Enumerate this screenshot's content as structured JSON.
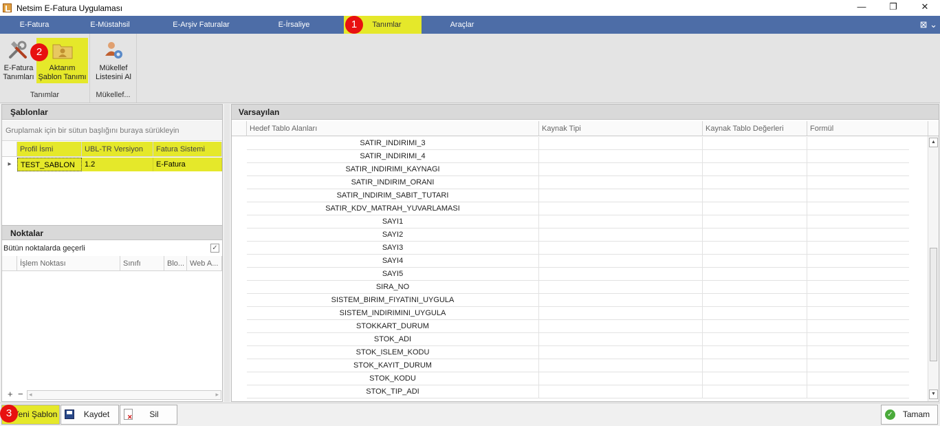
{
  "window": {
    "title": "Netsim E-Fatura Uygulaması",
    "minimize": "—",
    "restore": "❐",
    "close": "✕"
  },
  "menu": {
    "items": [
      "E-Fatura",
      "E-Müstahsil",
      "E-Arşiv Faturalar",
      "E-İrsaliye",
      "Tanımlar",
      "Araçlar"
    ],
    "active": "Tanımlar",
    "right_icon": "⊠ ⌄"
  },
  "ribbon": {
    "groups": [
      {
        "label": "Tanımlar",
        "buttons": [
          {
            "line1": "E-Fatura",
            "line2": "Tanımları",
            "icon": "tools-icon"
          },
          {
            "line1": "Aktarım",
            "line2": "Şablon Tanımı",
            "icon": "folder-user-icon"
          }
        ]
      },
      {
        "label": "Mükellef...",
        "buttons": [
          {
            "line1": "Mükellef",
            "line2": "Listesini Al",
            "icon": "users-gear-icon"
          }
        ]
      }
    ]
  },
  "badges": [
    "1",
    "2",
    "3"
  ],
  "sablonlar": {
    "title": "Şablonlar",
    "group_hint": "Gruplamak için bir sütun başlığını buraya sürükleyin",
    "columns": [
      "Profil İsmi",
      "UBL-TR Versiyon",
      "Fatura Sistemi"
    ],
    "rows": [
      [
        "TEST_SABLON",
        "1.2",
        "E-Fatura"
      ]
    ],
    "row_marker": "▸"
  },
  "noktalar": {
    "title": "Noktalar",
    "all_points_label": "Bütün noktalarda geçerli",
    "all_points_checked": true,
    "columns": [
      "İşlem Noktası",
      "Sınıfı",
      "Blo...",
      "Web A..."
    ],
    "add": "+",
    "remove": "−",
    "scroll_left": "◂",
    "scroll_right": "▸"
  },
  "varsayilan": {
    "title": "Varsayılan",
    "columns": [
      "Hedef Tablo Alanları",
      "Kaynak Tipi",
      "Kaynak Tablo Değerleri",
      "Formül"
    ],
    "rows": [
      "SATIR_INDIRIMI_3",
      "SATIR_INDIRIMI_4",
      "SATIR_INDIRIMI_KAYNAGI",
      "SATIR_INDIRIM_ORANI",
      "SATIR_INDIRIM_SABIT_TUTARI",
      "SATIR_KDV_MATRAH_YUVARLAMASI",
      "SAYI1",
      "SAYI2",
      "SAYI3",
      "SAYI4",
      "SAYI5",
      "SIRA_NO",
      "SISTEM_BIRIM_FIYATINI_UYGULA",
      "SISTEM_INDIRIMINI_UYGULA",
      "STOKKART_DURUM",
      "STOK_ADI",
      "STOK_ISLEM_KODU",
      "STOK_KAYIT_DURUM",
      "STOK_KODU",
      "STOK_TIP_ADI"
    ],
    "scroll_up": "▲",
    "scroll_down": "▼"
  },
  "buttons": {
    "new": "Yeni Şablon",
    "save": "Kaydet",
    "delete": "Sil",
    "ok": "Tamam"
  },
  "colors": {
    "highlight": "#e5e82a",
    "menubar": "#4d6da7",
    "badge": "#e81010"
  }
}
